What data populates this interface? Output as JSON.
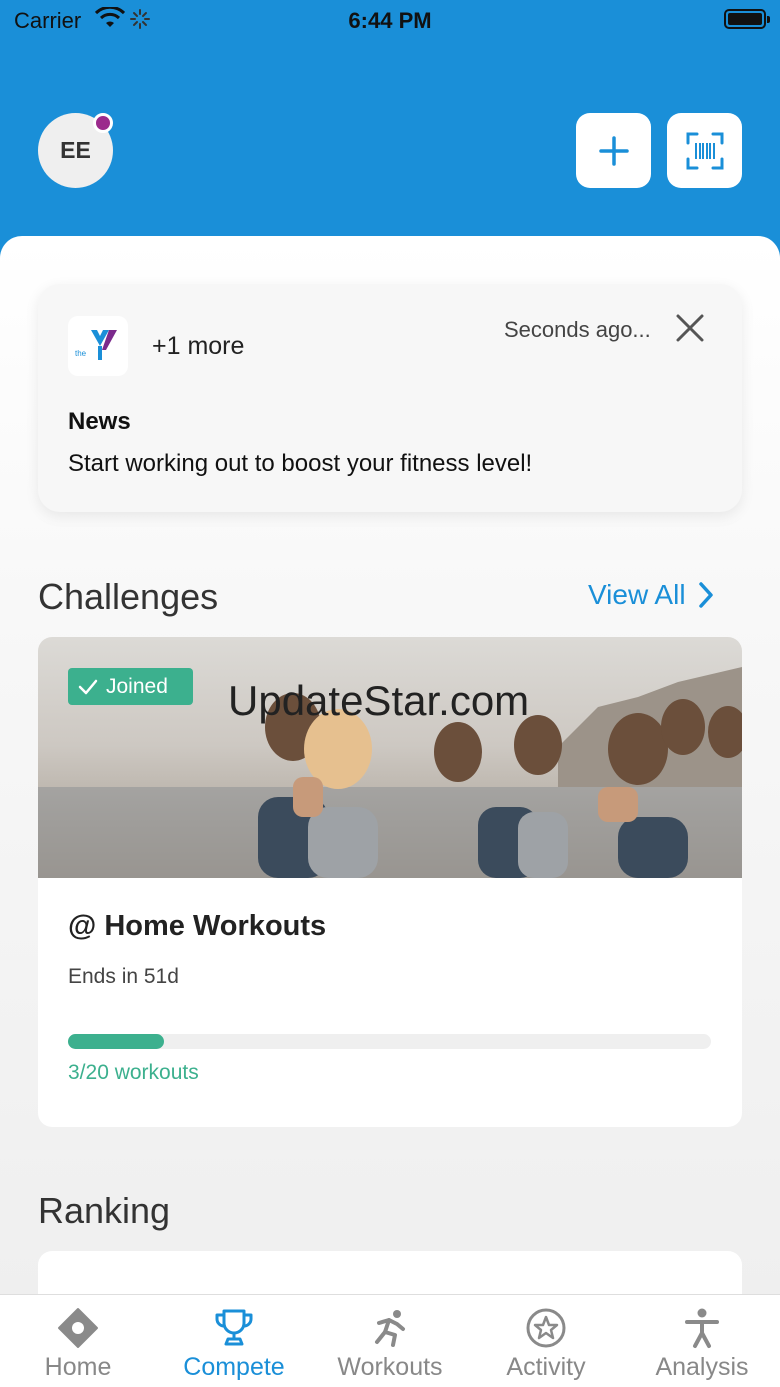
{
  "status_bar": {
    "carrier": "Carrier",
    "time": "6:44 PM"
  },
  "header": {
    "avatar_initials": "EE"
  },
  "news_card": {
    "logo_text": "the",
    "more_label": "+1 more",
    "timestamp": "Seconds ago...",
    "title": "News",
    "body": "Start working out to boost your fitness level!"
  },
  "challenges": {
    "section_title": "Challenges",
    "view_all_label": "View All",
    "card": {
      "badge_label": "Joined",
      "watermark": "UpdateStar.com",
      "title": "@ Home Workouts",
      "ends": "Ends in 51d",
      "progress_text": "3/20 workouts",
      "progress_fraction": 0.15
    }
  },
  "ranking": {
    "section_title": "Ranking"
  },
  "tabs": [
    {
      "label": "Home",
      "icon": "home-diamond-icon",
      "active": false
    },
    {
      "label": "Compete",
      "icon": "trophy-icon",
      "active": true
    },
    {
      "label": "Workouts",
      "icon": "runner-icon",
      "active": false
    },
    {
      "label": "Activity",
      "icon": "star-badge-icon",
      "active": false
    },
    {
      "label": "Analysis",
      "icon": "person-icon",
      "active": false
    }
  ],
  "colors": {
    "primary_blue": "#1a8fd8",
    "accent_green": "#3cb08e",
    "notification_purple": "#9b2a8c"
  }
}
